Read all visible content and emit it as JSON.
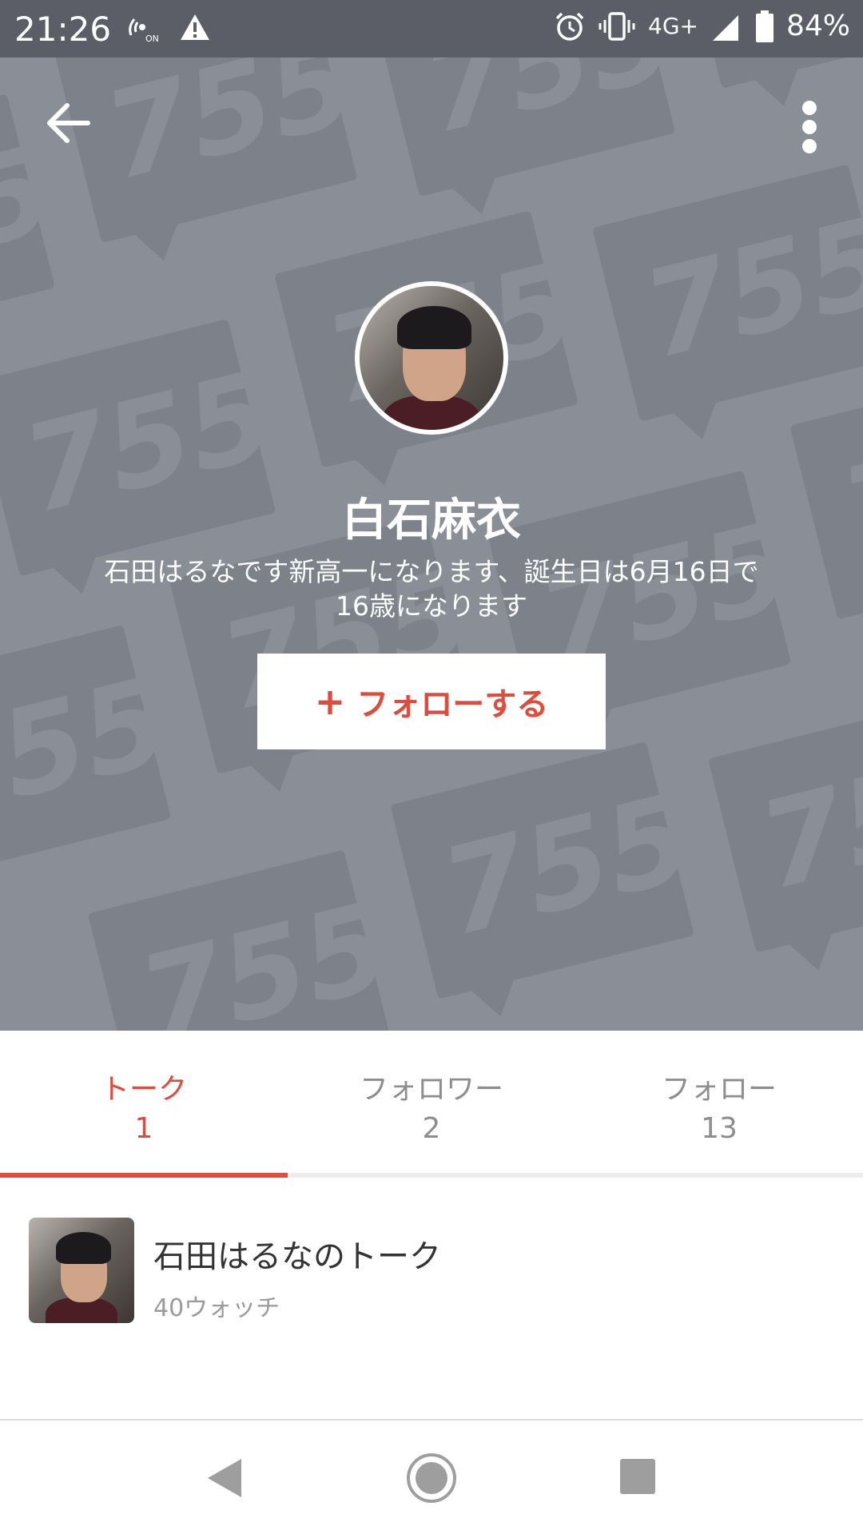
{
  "status_bar": {
    "time": "21:26",
    "network": "4G+",
    "battery": "84%",
    "icons": [
      "wifi-calling-icon",
      "warning-icon",
      "alarm-icon",
      "vibrate-icon",
      "signal-icon",
      "battery-icon"
    ]
  },
  "header": {
    "back_icon": "arrow-left-icon",
    "menu_icon": "more-vertical-icon",
    "pattern_text": "755",
    "colors": {
      "background": "#8a8e97",
      "pattern": "#7d818a"
    }
  },
  "profile": {
    "name": "白石麻衣",
    "bio": "石田はるなです新高一になります、誕生日は6月16日で16歳になります",
    "follow_button": {
      "plus": "+",
      "label": "フォローする"
    }
  },
  "tabs": [
    {
      "label": "トーク",
      "count": "1",
      "active": true
    },
    {
      "label": "フォロワー",
      "count": "2",
      "active": false
    },
    {
      "label": "フォロー",
      "count": "13",
      "active": false
    }
  ],
  "talk_list": [
    {
      "title": "石田はるなのトーク",
      "subtitle": "40ウォッチ"
    }
  ],
  "accent_color": "#e24a3b",
  "nav_bar": {
    "icons": [
      "nav-back-icon",
      "nav-home-icon",
      "nav-recent-icon"
    ]
  }
}
